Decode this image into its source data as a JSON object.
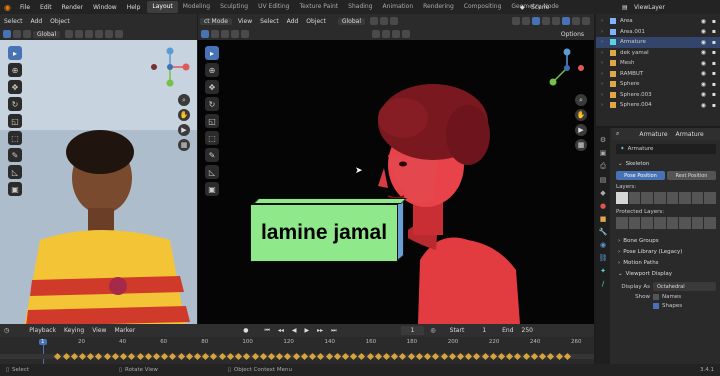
{
  "menu": [
    "File",
    "Edit",
    "Render",
    "Window",
    "Help"
  ],
  "workspaces": [
    {
      "label": "Layout",
      "active": true
    },
    {
      "label": "Modeling"
    },
    {
      "label": "Sculpting"
    },
    {
      "label": "UV Editing"
    },
    {
      "label": "Texture Paint"
    },
    {
      "label": "Shading"
    },
    {
      "label": "Animation"
    },
    {
      "label": "Rendering"
    },
    {
      "label": "Compositing"
    },
    {
      "label": "Geometry Node"
    }
  ],
  "scene": {
    "label": "Scene"
  },
  "view_layer": {
    "label": "ViewLayer"
  },
  "left_view": {
    "menu": [
      "Select",
      "Add",
      "Object"
    ],
    "transform": "Global"
  },
  "main_view": {
    "mode": "ct Mode",
    "menu": [
      "View",
      "Select",
      "Add",
      "Object"
    ],
    "transform": "Global",
    "options": "Options"
  },
  "overlay_caption": {
    "text": "lamine jamal",
    "color": "#8fe88a",
    "side_color": "#6aa0d8"
  },
  "outliner": {
    "items": [
      {
        "label": "Area",
        "icon_color": "#7fb3ff"
      },
      {
        "label": "Area.001",
        "icon_color": "#7fb3ff"
      },
      {
        "label": "Armature",
        "icon_color": "#5bd4e0",
        "selected": true
      },
      {
        "label": "dek yamal",
        "icon_color": "#e0a64a"
      },
      {
        "label": "Mesh",
        "icon_color": "#e0a64a"
      },
      {
        "label": "RAMBUT",
        "icon_color": "#e0a64a"
      },
      {
        "label": "Sphere",
        "icon_color": "#e0a64a"
      },
      {
        "label": "Sphere.003",
        "icon_color": "#e0a64a"
      },
      {
        "label": "Sphere.004",
        "icon_color": "#e0a64a"
      }
    ]
  },
  "properties": {
    "object_name": "Armature",
    "data_name": "Armature",
    "skeleton_label": "Skeleton",
    "pose_position": "Pose Position",
    "rest_position": "Rest Position",
    "layers_label": "Layers:",
    "protected_layers_label": "Protected Layers:",
    "sections": [
      "Bone Groups",
      "Pose Library (Legacy)",
      "Motion Paths",
      "Viewport Display"
    ],
    "display_as_label": "Display As",
    "display_as_value": "Octahedral",
    "show_label": "Show",
    "show_names": "Names",
    "show_shapes": "Shapes"
  },
  "timeline": {
    "menu": [
      "Playback",
      "Keying",
      "View",
      "Marker"
    ],
    "current_frame": "1",
    "start_label": "Start",
    "start": "1",
    "end_label": "End",
    "end": "250",
    "ticks": [
      "1",
      "20",
      "40",
      "60",
      "80",
      "100",
      "120",
      "140",
      "160",
      "180",
      "200",
      "220",
      "240",
      "260"
    ],
    "playhead": "1"
  },
  "status": {
    "select": "Select",
    "rotate": "Rotate View",
    "context": "Object Context Menu",
    "version": "3.4.1"
  }
}
